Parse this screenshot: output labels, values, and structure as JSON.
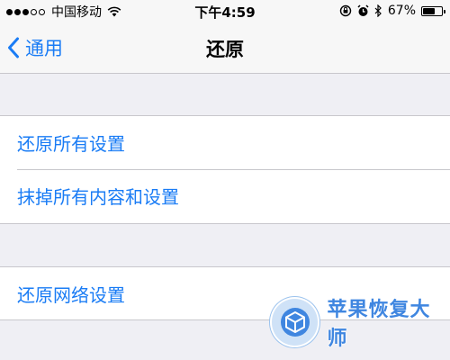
{
  "status_bar": {
    "carrier": "中国移动",
    "time": "下午4:59",
    "battery_percent": "67%",
    "battery_level": 0.67,
    "signal_bars_filled": 3,
    "signal_bars_total": 5,
    "icons": [
      "wifi-icon",
      "rotation-lock-icon",
      "alarm-icon",
      "bluetooth-icon",
      "battery-icon"
    ]
  },
  "nav": {
    "back_label": "通用",
    "title": "还原"
  },
  "groups": [
    {
      "items": [
        {
          "label": "还原所有设置"
        },
        {
          "label": "抹掉所有内容和设置"
        }
      ]
    },
    {
      "items": [
        {
          "label": "还原网络设置"
        }
      ]
    }
  ],
  "watermark": {
    "text": "苹果恢复大师",
    "icon": "cube-logo-icon"
  },
  "colors": {
    "accent": "#1a7cf5",
    "background": "#efeff4",
    "cell_background": "#ffffff",
    "separator": "#c8c7cc"
  }
}
